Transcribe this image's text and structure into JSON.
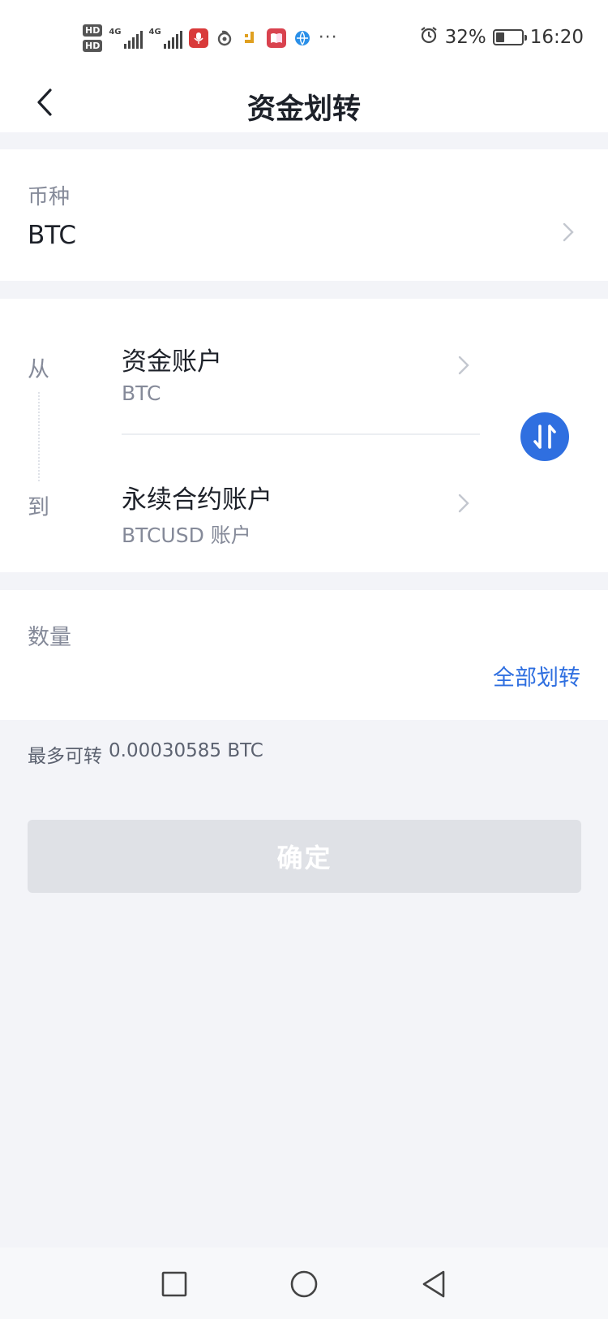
{
  "status_bar": {
    "hd_1": "HD",
    "hd_2": "HD",
    "net_1": "4G",
    "net_2": "4G",
    "dots": "···",
    "battery_percent": "32%",
    "battery_level": 0.32,
    "time": "16:20"
  },
  "header": {
    "title": "资金划转"
  },
  "coin": {
    "label": "币种",
    "value": "BTC"
  },
  "transfer": {
    "from_label": "从",
    "to_label": "到",
    "from_account": "资金账户",
    "from_sub": "BTC",
    "to_account": "永续合约账户",
    "to_sub": "BTCUSD 账户"
  },
  "amount": {
    "label": "数量",
    "value": "",
    "placeholder": "",
    "transfer_all": "全部划转"
  },
  "max": {
    "label": "最多可转",
    "value": "0.00030585 BTC"
  },
  "confirm_label": "确定",
  "colors": {
    "accent": "#2f6fe0",
    "background": "#f3f4f8",
    "button_disabled": "#dfe1e6"
  }
}
